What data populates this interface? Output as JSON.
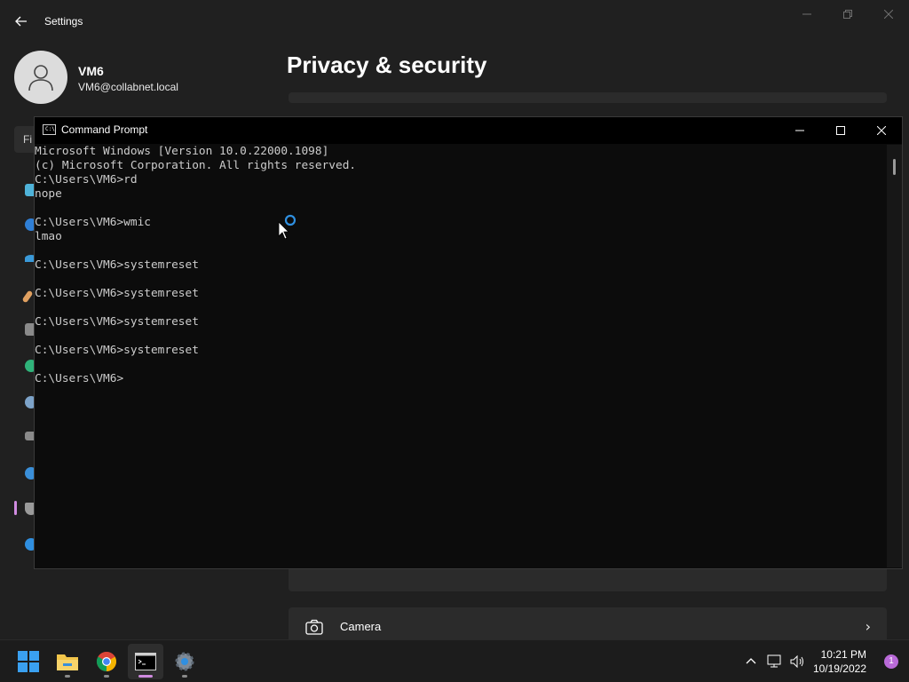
{
  "settings": {
    "app_title": "Settings",
    "user": {
      "name": "VM6",
      "email": "VM6@collabnet.local"
    },
    "search_stub": "Fi",
    "page_title": "Privacy & security",
    "camera_label": "Camera",
    "accent_color": "#d08be0",
    "nav_icon_names": [
      "system-icon",
      "bluetooth-icon",
      "network-icon",
      "personalization-icon",
      "apps-icon",
      "accounts-icon",
      "time-language-icon",
      "gaming-icon",
      "accessibility-icon",
      "privacy-shield-icon",
      "windows-update-icon"
    ]
  },
  "cmd": {
    "title": "Command Prompt",
    "lines": [
      "Microsoft Windows [Version 10.0.22000.1098]",
      "(c) Microsoft Corporation. All rights reserved.",
      "C:\\Users\\VM6>rd",
      "nope",
      "",
      "C:\\Users\\VM6>wmic",
      "lmao",
      "",
      "C:\\Users\\VM6>systemreset",
      "",
      "C:\\Users\\VM6>systemreset",
      "",
      "C:\\Users\\VM6>systemreset",
      "",
      "C:\\Users\\VM6>systemreset",
      "",
      "C:\\Users\\VM6>"
    ]
  },
  "taskbar": {
    "apps": [
      "start-button",
      "file-explorer",
      "chrome",
      "command-prompt",
      "settings"
    ],
    "time": "10:21 PM",
    "date": "10/19/2022",
    "notification_count": "1"
  }
}
